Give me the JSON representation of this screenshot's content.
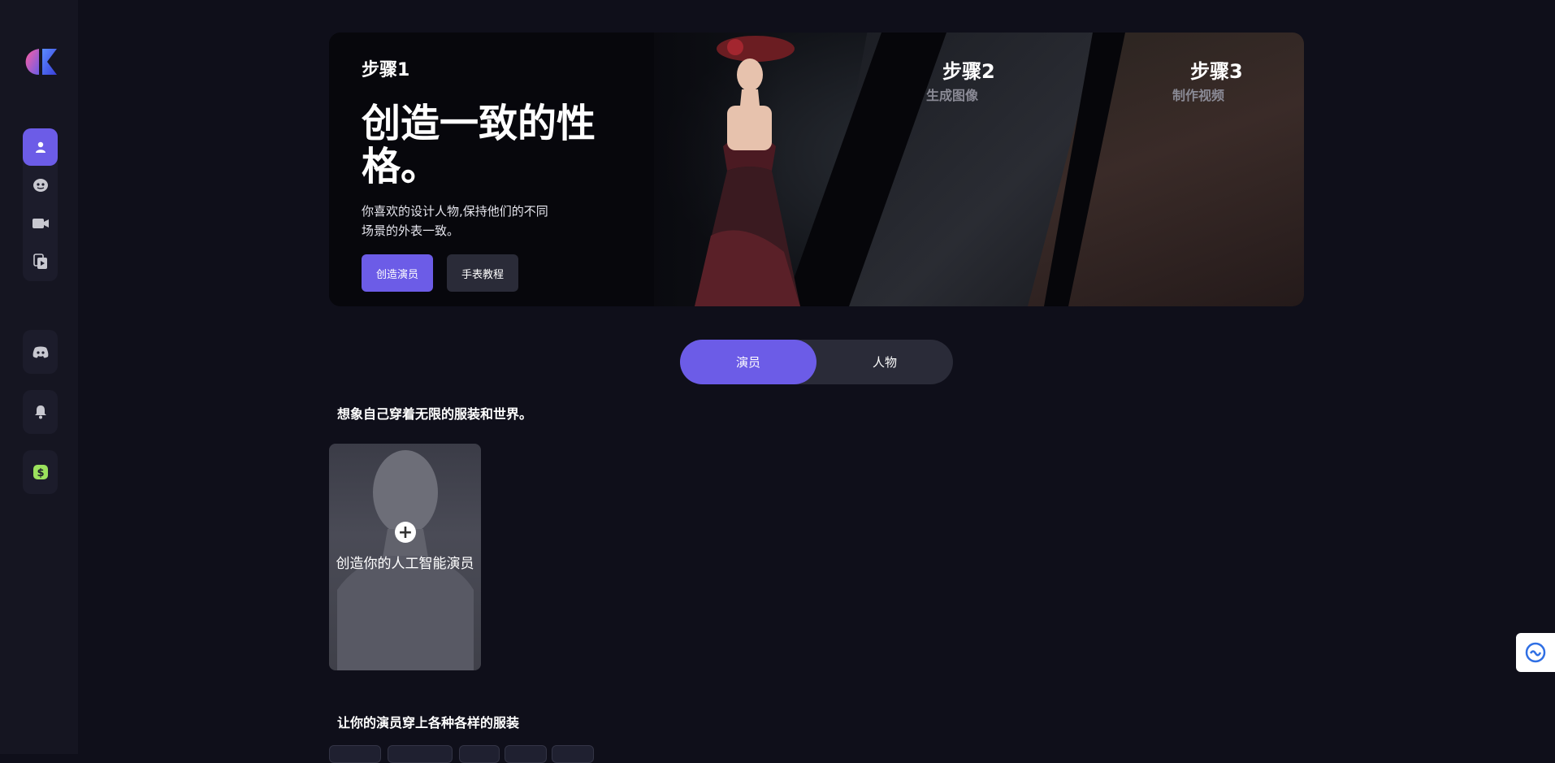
{
  "banner": {
    "step1": "步骤1",
    "title": "创造一致的性格。",
    "desc": "你喜欢的设计人物,保持他们的不同场景的外表一致。",
    "btn_create": "创造演员",
    "btn_tutorial": "手表教程",
    "step2": "步骤2",
    "step2_sub": "生成图像",
    "step3": "步骤3",
    "step3_sub": "制作视频"
  },
  "toggle": {
    "actor": "演员",
    "character": "人物",
    "selected": "演员"
  },
  "section1": {
    "title": "想象自己穿着无限的服装和世界。"
  },
  "card": {
    "label": "创造你的人工智能演员"
  },
  "section2": {
    "title": "让你的演员穿上各种各样的服装"
  },
  "colors": {
    "accent": "#6c5ce7",
    "background": "#0f0f1a",
    "sidebar": "#151521"
  },
  "icons": {
    "nav": [
      "user-icon",
      "face-icon",
      "video-icon",
      "video-library-icon"
    ],
    "discord": "discord-icon",
    "bell": "bell-icon",
    "dollar": "dollar-icon",
    "widget": "support-icon"
  }
}
